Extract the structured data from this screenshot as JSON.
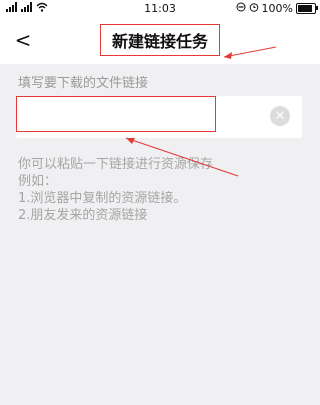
{
  "status_bar": {
    "time": "11:03",
    "battery_label": "100%",
    "battery_level": 1.0,
    "icons": [
      "sim-signal-icon",
      "signal-icon",
      "wifi-icon",
      "do-not-disturb-icon",
      "alarm-icon",
      "battery-icon"
    ]
  },
  "header": {
    "back_glyph": "<",
    "title": "新建链接任务"
  },
  "form": {
    "label": "填写要下载的文件链接",
    "input_value": "",
    "input_placeholder": "",
    "clear_glyph": "✕"
  },
  "help": {
    "lines": [
      "你可以粘贴一下链接进行资源保存",
      "例如：",
      "1.浏览器中复制的资源链接。",
      "2.朋友发来的资源链接"
    ]
  },
  "annotation": {
    "color": "#e53935"
  }
}
